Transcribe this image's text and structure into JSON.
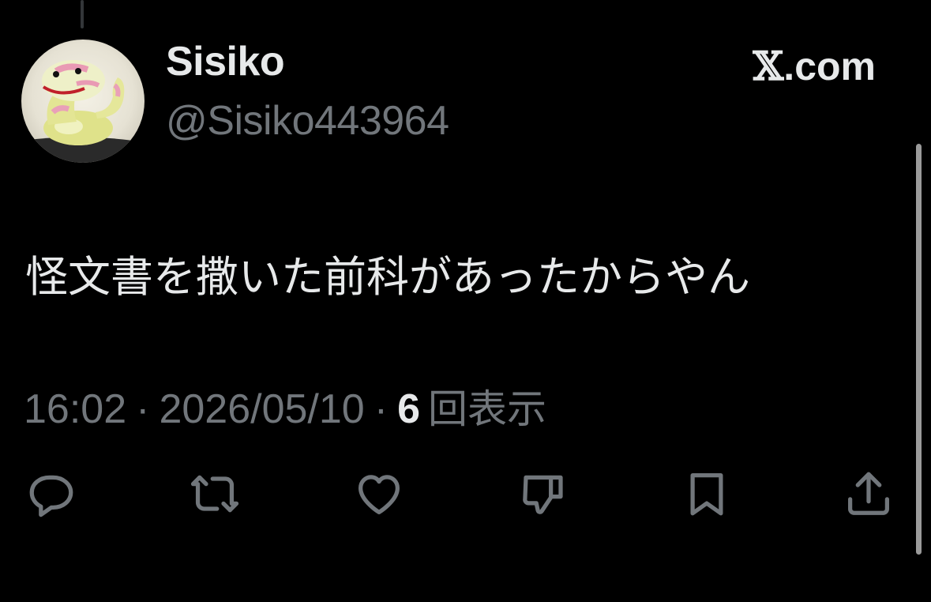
{
  "post": {
    "author": {
      "display_name": "Sisiko",
      "handle": "@Sisiko443964",
      "avatar": "snake-plush-avatar"
    },
    "brand": {
      "mark": "𝕏",
      "suffix": ".com"
    },
    "text": "怪文書を撒いた前科があったからやん",
    "meta": {
      "time": "16:02",
      "separator": "·",
      "date": "2026/05/10",
      "views_count": "6",
      "views_label": "回表示"
    },
    "actions": [
      {
        "icon": "reply-icon"
      },
      {
        "icon": "repost-icon"
      },
      {
        "icon": "like-icon"
      },
      {
        "icon": "dislike-icon"
      },
      {
        "icon": "bookmark-icon"
      },
      {
        "icon": "share-icon"
      }
    ]
  },
  "colors": {
    "background": "#000000",
    "primary_text": "#e7e9ea",
    "secondary_text": "#71767b",
    "icon": "#71767b"
  }
}
